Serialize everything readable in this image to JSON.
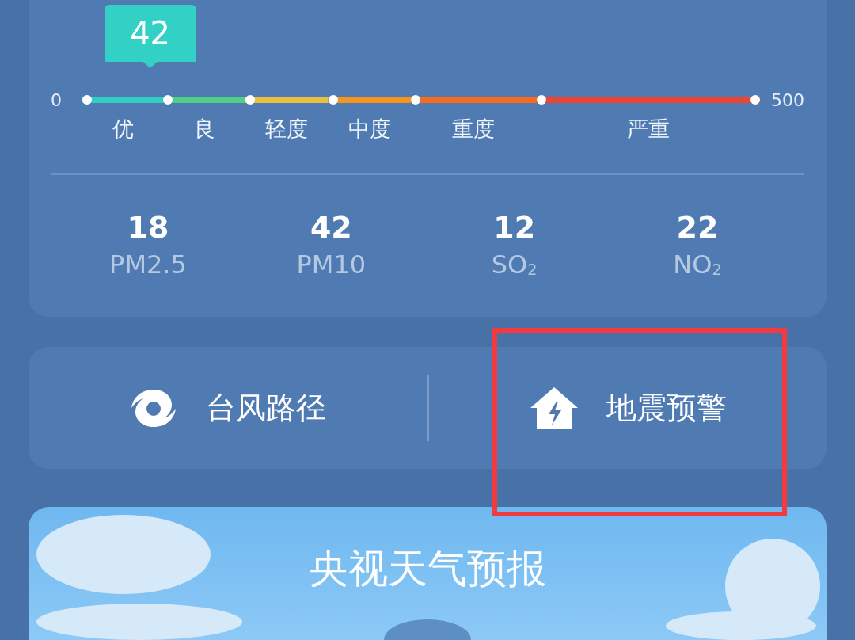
{
  "aqi": {
    "value": "42",
    "level": 0.1,
    "scale_min": "0",
    "scale_max": "500",
    "grades": [
      {
        "label": "优",
        "color": "#33cdc6"
      },
      {
        "label": "良",
        "color": "#4fcf86"
      },
      {
        "label": "轻度",
        "color": "#e8c140"
      },
      {
        "label": "中度",
        "color": "#f6951d"
      },
      {
        "label": "重度",
        "color": "#f6691f"
      },
      {
        "label": "严重",
        "color": "#ee4433"
      }
    ],
    "pollutants": [
      {
        "value": "18",
        "label": "PM2.5"
      },
      {
        "value": "42",
        "label": "PM10"
      },
      {
        "value": "12",
        "label": "SO$_{2}$"
      },
      {
        "value": "22",
        "label": "NO$_{2}$"
      }
    ]
  },
  "shortcuts": [
    {
      "kind": "typhoon",
      "label": "台风路径"
    },
    {
      "kind": "earthquake",
      "label": "地震预警"
    }
  ],
  "video": {
    "title": "央视天气预报"
  }
}
